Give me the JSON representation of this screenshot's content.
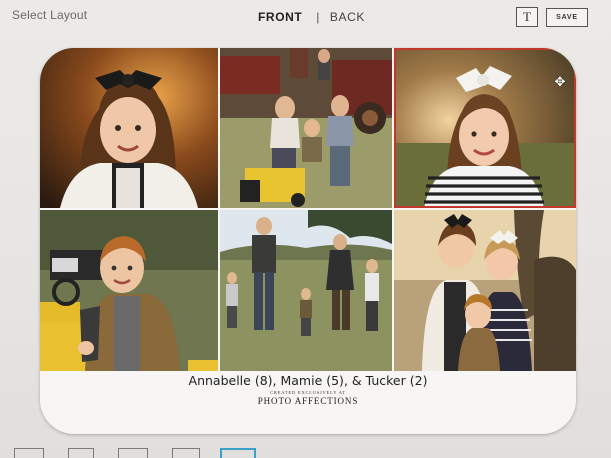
{
  "header": {
    "select_layout": "Select Layout",
    "front_tab": "FRONT",
    "separator": "|",
    "back_tab": "BACK",
    "text_button": "T",
    "save_button": "SAVE"
  },
  "card": {
    "photos": [
      {
        "id": "photo-1",
        "selected": false
      },
      {
        "id": "photo-2",
        "selected": false
      },
      {
        "id": "photo-3",
        "selected": true
      },
      {
        "id": "photo-4",
        "selected": false
      },
      {
        "id": "photo-5",
        "selected": false
      },
      {
        "id": "photo-6",
        "selected": false
      }
    ],
    "caption": {
      "names": "Annabelle (8), Mamie (5), & Tucker (2)",
      "created_by": "CREATED EXCLUSIVELY AT",
      "brand": "PHOTO AFFECTIONS"
    }
  },
  "colors": {
    "selection_outline": "#c0392b",
    "active_layout_icon": "#3aa0c8"
  },
  "icons": {
    "move_handle": "move-arrows-icon"
  }
}
